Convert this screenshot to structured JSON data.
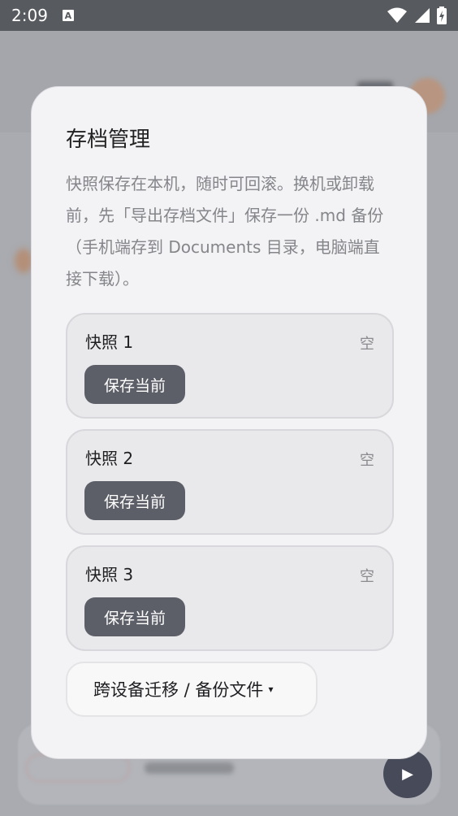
{
  "status_bar": {
    "time": "2:09",
    "notification_icon": "a-icon",
    "icons": [
      "wifi-icon",
      "signal-icon",
      "battery-icon"
    ]
  },
  "dialog": {
    "title": "存档管理",
    "description": "快照保存在本机，随时可回滚。换机或卸载前，先「导出存档文件」保存一份 .md 备份（手机端存到 Documents 目录，电脑端直接下载）。",
    "slots": [
      {
        "name": "快照 1",
        "status": "空",
        "button": "保存当前"
      },
      {
        "name": "快照 2",
        "status": "空",
        "button": "保存当前"
      },
      {
        "name": "快照 3",
        "status": "空",
        "button": "保存当前"
      }
    ],
    "migrate_label": "跨设备迁移 / 备份文件",
    "migrate_caret": "▾"
  },
  "colors": {
    "dialog_bg": "#f3f3f5",
    "button_bg": "#5d5f68",
    "overlay": "#a9abb0"
  }
}
